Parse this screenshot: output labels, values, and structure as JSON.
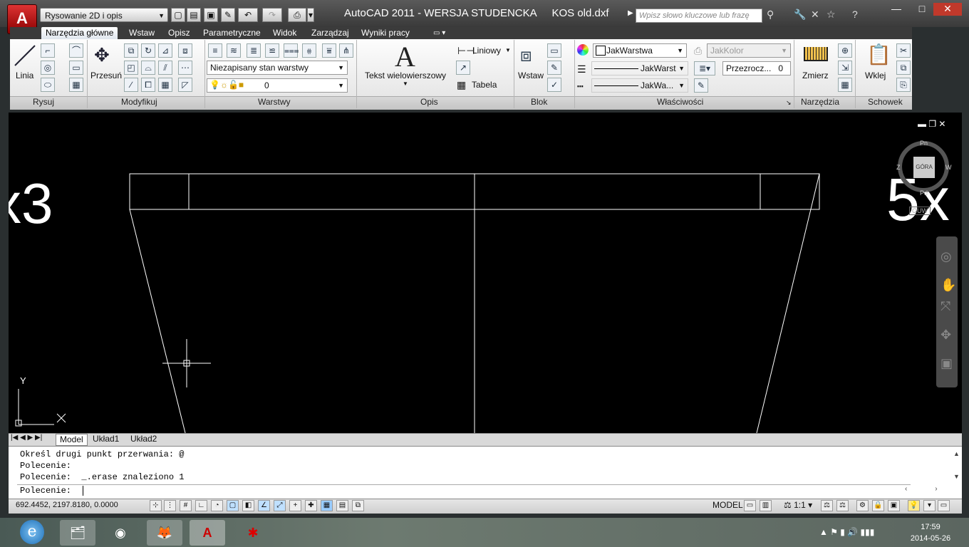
{
  "titlebar": {
    "workspace": "Rysowanie 2D i opis",
    "title": "AutoCAD 2011 - WERSJA STUDENCKA",
    "filename": "KOS old.dxf",
    "search_placeholder": "Wpisz słowo kluczowe lub frazę"
  },
  "tabs": [
    "Narzędzia główne",
    "Wstaw",
    "Opisz",
    "Parametryczne",
    "Widok",
    "Zarządzaj",
    "Wyniki pracy"
  ],
  "ribbon": {
    "draw": {
      "line_label": "Linia",
      "panel": "Rysuj"
    },
    "modify": {
      "move_label": "Przesuń",
      "panel": "Modyfikuj"
    },
    "layers": {
      "layer_state": "Niezapisany stan warstwy",
      "current_layer": "0",
      "panel": "Warstwy"
    },
    "annotation": {
      "mtext_label": "Tekst wielowierszowy",
      "linear_label": "Liniowy",
      "table_label": "Tabela",
      "panel": "Opis"
    },
    "block": {
      "insert_label": "Wstaw",
      "panel": "Blok"
    },
    "properties": {
      "color": "JakWarstwa",
      "linetype": "JakWarst",
      "lineweight": "JakWa...",
      "plotstyle": "JakKolor",
      "transparency_label": "Przezrocz...",
      "transparency_value": "0",
      "panel": "Właściwości"
    },
    "utilities": {
      "measure_label": "Zmierz",
      "panel": "Narzędzia"
    },
    "clipboard": {
      "paste_label": "Wklej",
      "panel": "Schowek"
    }
  },
  "canvas": {
    "text_left": "x3",
    "text_right": "5x",
    "viewcube": {
      "north": "Pn",
      "south": "Pd",
      "west": "Z",
      "east": "W",
      "top": "GÓRA",
      "wcs": "GUW"
    },
    "ucs_y": "Y",
    "ucs_x": "X"
  },
  "layout_tabs": [
    "Model",
    "Układ1",
    "Układ2"
  ],
  "command": {
    "history": [
      "Określ drugi punkt przerwania: @",
      "Polecenie:",
      "Polecenie:  _.erase znaleziono 1"
    ],
    "prompt": "Polecenie:"
  },
  "status": {
    "coords": "692.4452, 2197.8180, 0.0000",
    "model": "MODEL",
    "scale": "1:1"
  },
  "clock": {
    "time": "17:59",
    "date": "2014-05-26"
  },
  "colors": {
    "canvas": "#000000",
    "accent": "#c0392b",
    "ribbon": "#eaeaea"
  }
}
